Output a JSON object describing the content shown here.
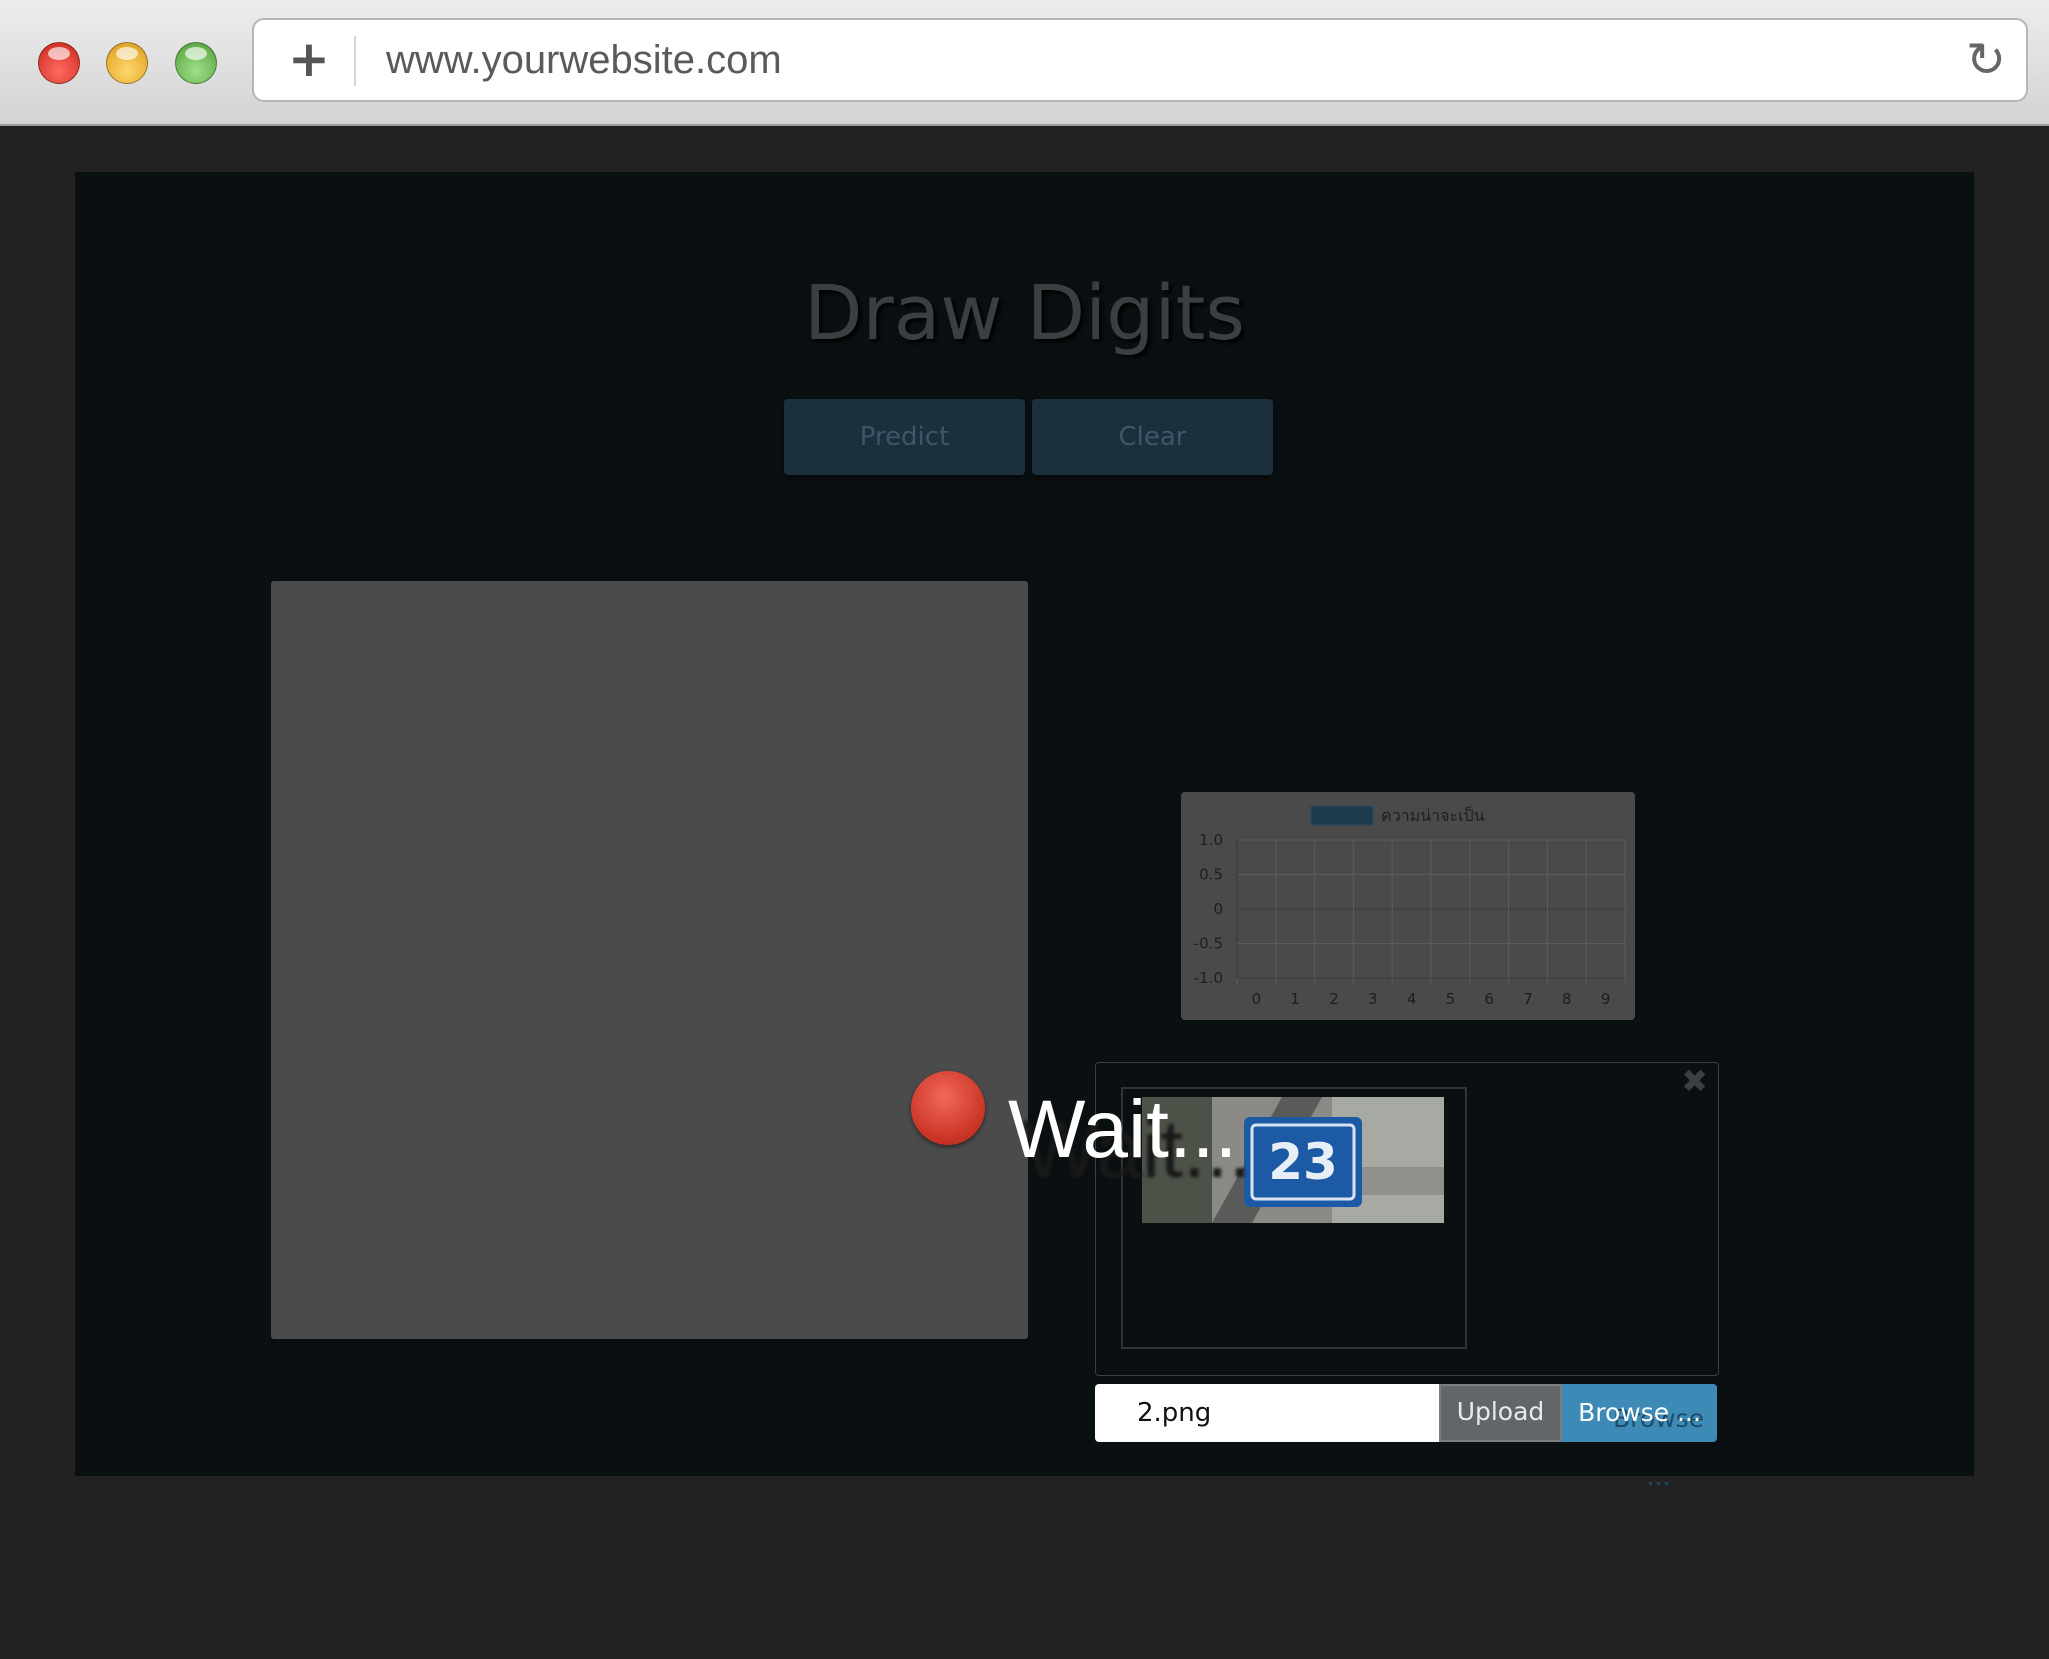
{
  "browser": {
    "url": "www.yourwebsite.com",
    "new_tab_icon": "plus-icon",
    "reload_icon": "reload-icon"
  },
  "app": {
    "title": "Draw Digits",
    "predict_label": "Predict",
    "clear_label": "Clear"
  },
  "chart_data": {
    "type": "bar",
    "legend": [
      "ความน่าจะเป็น"
    ],
    "categories": [
      "0",
      "1",
      "2",
      "3",
      "4",
      "5",
      "6",
      "7",
      "8",
      "9"
    ],
    "series": [
      {
        "name": "ความน่าจะเป็น",
        "values": [
          0,
          0,
          0,
          0,
          0,
          0,
          0,
          0,
          0,
          0
        ]
      }
    ],
    "y_ticks": [
      "1.0",
      "0.5",
      "0",
      "-0.5",
      "-1.0"
    ],
    "ylim": [
      -1.0,
      1.0
    ],
    "grid": true,
    "legend_position": "top",
    "colors": {
      "series": "#1e3a4f"
    }
  },
  "upload": {
    "preview_alt": "23",
    "file_name": "2.png",
    "upload_label": "Upload",
    "browse_label": "Browse ...",
    "close_icon": "close-icon"
  },
  "overlay": {
    "wait_text": "Wait...",
    "colors": {
      "dot": "#d9392b"
    }
  }
}
